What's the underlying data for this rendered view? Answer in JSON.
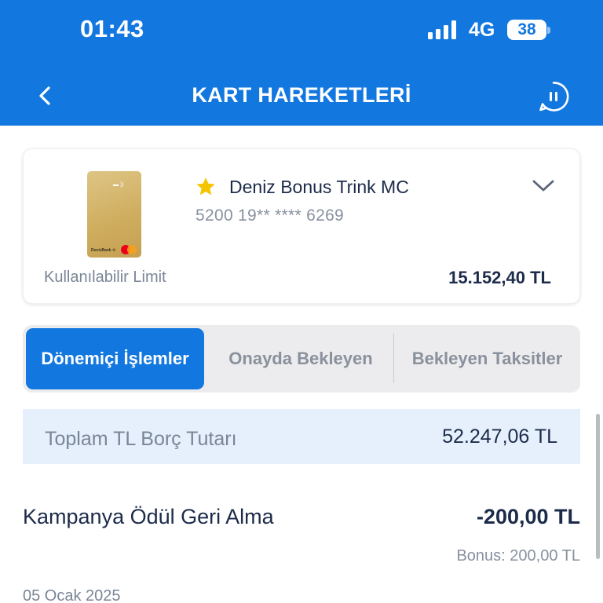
{
  "status_bar": {
    "time": "01:43",
    "network": "4G",
    "battery": "38"
  },
  "header": {
    "title": "KART HAREKETLERİ",
    "back_icon": "chevron-left-icon",
    "chat_icon": "chat-pause-icon"
  },
  "card": {
    "name": "Deniz Bonus Trink MC",
    "number": "5200 19** **** 6269",
    "limit_label": "Kullanılabilir Limit",
    "limit_value": "15.152,40 TL",
    "favorite_color": "#f5c400",
    "expand_icon": "chevron-down-icon"
  },
  "tabs": [
    {
      "label": "Dönemiçi İşlemler",
      "active": true
    },
    {
      "label": "Onayda Bekleyen",
      "active": false
    },
    {
      "label": "Bekleyen Taksitler",
      "active": false
    }
  ],
  "total": {
    "label": "Toplam TL Borç Tutarı",
    "value": "52.247,06 TL"
  },
  "transaction": {
    "title": "Kampanya Ödül Geri Alma",
    "amount": "-200,00 TL",
    "bonus": "Bonus: 200,00 TL"
  },
  "date": "05 Ocak 2025",
  "colors": {
    "accent": "#1278e0",
    "text": "#1c2b4a",
    "muted": "#8891a0",
    "highlight_bg": "#e5f0fc"
  }
}
